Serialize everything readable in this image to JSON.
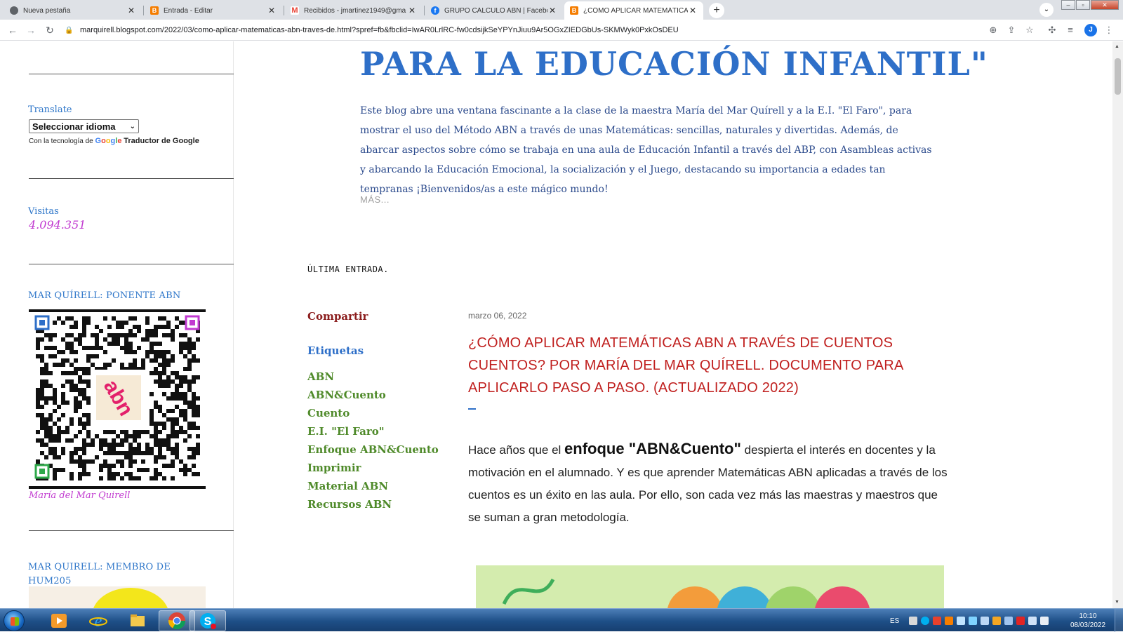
{
  "browser": {
    "tabs": [
      {
        "label": "Nueva pestaña",
        "icon": "globe-icon",
        "color": "#5f6368"
      },
      {
        "label": "Entrada - Editar",
        "icon": "blogger-icon",
        "color": "#f57d00"
      },
      {
        "label": "Recibidos - jmartinez1949@gma",
        "icon": "gmail-icon",
        "color": "#ea4335"
      },
      {
        "label": "GRUPO CÁLCULO ABN | Faceboo",
        "icon": "facebook-icon",
        "color": "#1877f2"
      },
      {
        "label": "¿CÓMO APLICAR MATEMÁTICAS",
        "icon": "blogger-icon",
        "color": "#f57d00"
      }
    ],
    "active_tab": 4,
    "url": "marquirell.blogspot.com/2022/03/como-aplicar-matematicas-abn-traves-de.html?spref=fb&fbclid=IwAR0LrlRC-fw0cdsijkSeYPYnJiuu9Ar5OGxZIEDGbUs-SKMWyk0PxkOsDEU",
    "profile_initial": "J"
  },
  "sidebar": {
    "translate_heading": "Translate",
    "language_select": "Seleccionar idioma",
    "powered_by": "Con la tecnología de",
    "google_word": "Google",
    "translator_link": "Traductor de Google",
    "visits_heading": "Visitas",
    "visits_count": "4.094.351",
    "speaker_heading": "MAR QUÍRELL: PONENTE ABN",
    "speaker_caption": "María del Mar Quirell",
    "member_heading": "MAR QUIRELL: MEMBRO DE HUM205"
  },
  "blog": {
    "title": "PARA LA EDUCACIÓN INFANTIL\"",
    "description": "Este blog abre una ventana fascinante a la clase de la maestra María del Mar Quírell y a la E.I. \"El Faro\", para mostrar el uso del Método ABN a través de unas Matemáticas: sencillas, naturales y divertidas. Además, de abarcar aspectos sobre cómo se trabaja en una aula de Educación Infantil a través del ABP, con Asambleas activas y abarcando la Educación Emocional, la socialización y el Juego, destacando su importancia a edades tan tempranas ¡Bienvenidos/as a este mágico mundo!",
    "more_link": "MÁS...",
    "latest_label": "ÚLTIMA ENTRADA."
  },
  "post_sidebar": {
    "share_label": "Compartir",
    "tags_label": "Etiquetas",
    "tags": [
      "ABN",
      "ABN&Cuento",
      "Cuento",
      "E.I. \"El Faro\"",
      "Enfoque ABN&Cuento",
      "Imprimir",
      "Material ABN",
      "Recursos ABN"
    ]
  },
  "post": {
    "date": "marzo 06, 2022",
    "title": "¿CÓMO APLICAR MATEMÁTICAS ABN A TRAVÉS DE CUENTOS CUENTOS? POR MARÍA DEL MAR QUÍRELL. DOCUMENTO PARA APLICARLO PASO A PASO. (ACTUALIZADO 2022)",
    "body_lead": " Hace años que el ",
    "body_emphasis": "enfoque \"ABN&Cuento\"",
    "body_rest": " despierta el interés en docentes y la motivación en el alumnado. Y es que aprender Matemáticas ABN aplicadas a través de los cuentos es un éxito en las aula. Por ello, son cada vez más las maestras y maestros que se suman a gran metodología."
  },
  "taskbar": {
    "apps": [
      "media-player-icon",
      "internet-explorer-icon",
      "file-explorer-icon",
      "chrome-icon",
      "skype-icon"
    ],
    "language": "ES",
    "time": "10:10",
    "date": "08/03/2022"
  },
  "colors": {
    "accent_blue": "#2e6fc8",
    "post_title_red": "#c0201f",
    "tag_green": "#4f8a2a",
    "visits_magenta": "#c13ad0"
  }
}
